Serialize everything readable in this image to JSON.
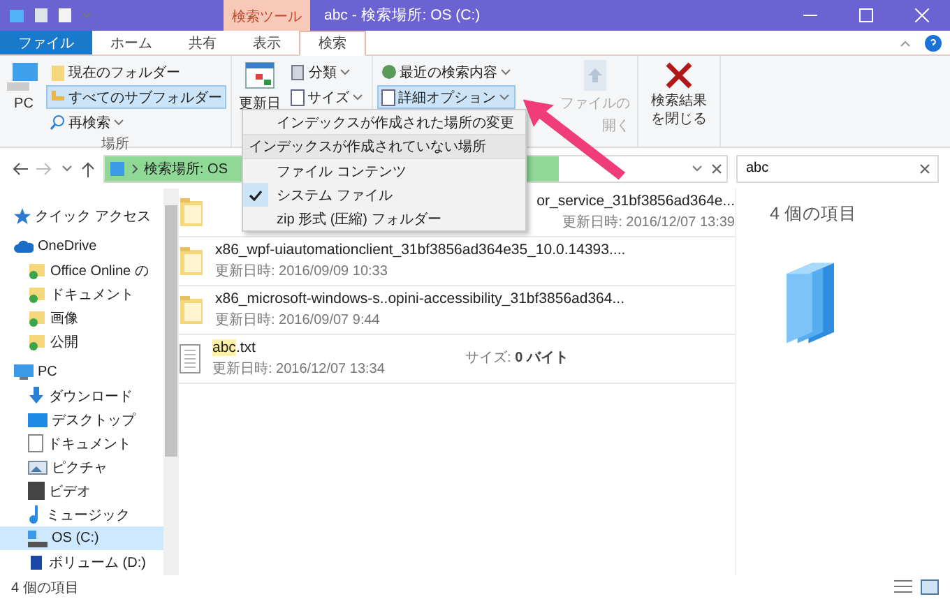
{
  "window": {
    "title": "abc - 検索場所: OS (C:)",
    "context_tab": "検索ツール"
  },
  "tabs": [
    {
      "label": "ファイル",
      "kind": "file",
      "selected": false
    },
    {
      "label": "ホーム",
      "kind": "tab",
      "selected": false
    },
    {
      "label": "共有",
      "kind": "tab",
      "selected": false
    },
    {
      "label": "表示",
      "kind": "tab",
      "selected": false
    },
    {
      "label": "検索",
      "kind": "tab",
      "selected": true
    }
  ],
  "ribbon": {
    "location": {
      "label": "場所",
      "pc": "PC",
      "scopes": [
        {
          "label": "現在のフォルダー",
          "selected": false
        },
        {
          "label": "すべてのサブフォルダー",
          "selected": true
        }
      ],
      "research": "再検索"
    },
    "refine": {
      "date": "更新日",
      "kind": "分類",
      "size": "サイズ"
    },
    "options": {
      "recent": "最近の検索内容",
      "advanced": {
        "label": "詳細オプション",
        "pressed": true
      },
      "open_location": {
        "lines": [
          "ファイルの",
          "開く"
        ],
        "disabled": true
      }
    },
    "close": {
      "label": "検索結果を閉じる"
    }
  },
  "menu": {
    "items": [
      {
        "kind": "item",
        "label": "インデックスが作成された場所の変更",
        "checked": false
      },
      {
        "kind": "header",
        "label": "インデックスが作成されていない場所"
      },
      {
        "kind": "item",
        "label": "ファイル コンテンツ",
        "checked": false
      },
      {
        "kind": "item",
        "label": "システム ファイル",
        "checked": true
      },
      {
        "kind": "item",
        "label": "zip 形式 (圧縮) フォルダー",
        "checked": false
      }
    ]
  },
  "address": {
    "path": "検索場所: OS",
    "level": 0.73
  },
  "search": {
    "value": "abc"
  },
  "nav": [
    {
      "label": "クイック アクセス",
      "kind": "star",
      "selected": false
    },
    {
      "label": "OneDrive",
      "kind": "cloud",
      "selected": false,
      "children": [
        {
          "label": "Office Online の",
          "kind": "synced",
          "selected": false
        },
        {
          "label": "ドキュメント",
          "kind": "synced",
          "selected": false
        },
        {
          "label": "画像",
          "kind": "synced",
          "selected": false
        },
        {
          "label": "公開",
          "kind": "synced",
          "selected": false
        }
      ]
    },
    {
      "label": "PC",
      "kind": "pc",
      "selected": false,
      "children": [
        {
          "label": "ダウンロード",
          "kind": "download",
          "selected": false
        },
        {
          "label": "デスクトップ",
          "kind": "desktop",
          "selected": false
        },
        {
          "label": "ドキュメント",
          "kind": "document",
          "selected": false
        },
        {
          "label": "ピクチャ",
          "kind": "picture",
          "selected": false
        },
        {
          "label": "ビデオ",
          "kind": "video",
          "selected": false
        },
        {
          "label": "ミュージック",
          "kind": "music",
          "selected": false
        },
        {
          "label": "OS (C:)",
          "kind": "drive",
          "selected": true
        },
        {
          "label": "ボリューム (D:)",
          "kind": "volume",
          "selected": false
        }
      ]
    }
  ],
  "files": [
    {
      "kind": "covered",
      "name_parts": [
        {
          "text": "or_service_31bf3856ad364e...",
          "match": false
        }
      ],
      "date": "更新日時: 2016/12/07 13:39"
    },
    {
      "kind": "folder",
      "name_parts": [
        {
          "text": "x86_wpf-uiautomationclient_31bf3856ad364e35_10.0.14393....",
          "match": false
        }
      ],
      "date": "更新日時: 2016/09/09 10:33"
    },
    {
      "kind": "folder",
      "name_parts": [
        {
          "text": "x86_microsoft-windows-s..opini-accessibility_31bf3856ad364...",
          "match": false
        }
      ],
      "date": "更新日時: 2016/09/07 9:44"
    },
    {
      "kind": "text",
      "name_parts": [
        {
          "text": "abc",
          "match": true
        },
        {
          "text": ".txt",
          "match": false
        }
      ],
      "date": "更新日時: 2016/12/07 13:34",
      "size": "サイズ: **0 バイト**"
    }
  ],
  "details": {
    "count": "4 個の項目"
  },
  "status_bar": {
    "count": "4 個の項目"
  }
}
